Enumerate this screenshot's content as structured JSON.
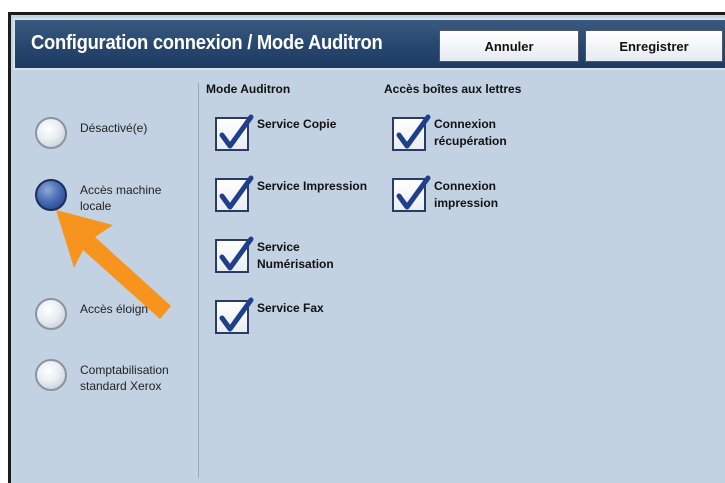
{
  "header": {
    "title": "Configuration connexion / Mode Auditron",
    "cancel_label": "Annuler",
    "save_label": "Enregistrer"
  },
  "radios": [
    {
      "label": "Désactivé(e)",
      "selected": false
    },
    {
      "label": "Accès machine locale",
      "selected": true
    },
    {
      "label": "Accès éloign",
      "selected": false
    },
    {
      "label": "Comptabilisation standard Xerox",
      "selected": false
    }
  ],
  "auditron": {
    "heading": "Mode Auditron",
    "items": [
      {
        "label": "Service Copie",
        "checked": true
      },
      {
        "label": "Service Impression",
        "checked": true
      },
      {
        "label": "Service Numérisation",
        "checked": true
      },
      {
        "label": "Service Fax",
        "checked": true
      }
    ]
  },
  "mailbox": {
    "heading": "Accès boîtes aux lettres",
    "items": [
      {
        "label": "Connexion récupération",
        "checked": true
      },
      {
        "label": "Connexion impression",
        "checked": true
      }
    ]
  },
  "colors": {
    "background": "#c3d2e2",
    "titlebar": "#27466e",
    "highlight_arrow": "#f7941d",
    "selected_radio": "#3f5fa8"
  },
  "icons": {
    "checkmark": "checkmark-icon",
    "pointer": "arrow-icon"
  }
}
